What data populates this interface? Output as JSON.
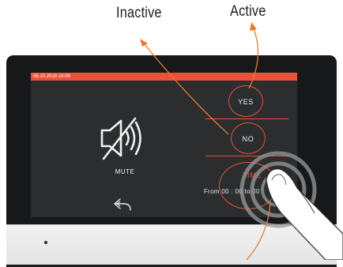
{
  "annotations": {
    "inactive_label": "Inactive",
    "active_label": "Active"
  },
  "status_bar": {
    "datetime": "06.10.2018  19:08",
    "color": "#e8513a"
  },
  "left_panel": {
    "icon": "speaker-muted-icon",
    "label": "MUTE",
    "back_icon": "back-arrow-icon"
  },
  "options": {
    "yes_label": "YES",
    "no_label": "NO",
    "time_label": "TIME",
    "time_range": "From  00 : 00    to 00"
  },
  "colors": {
    "accent": "#e8513a",
    "screen_bg": "#2b2d2f",
    "bezel": "#16181a"
  }
}
